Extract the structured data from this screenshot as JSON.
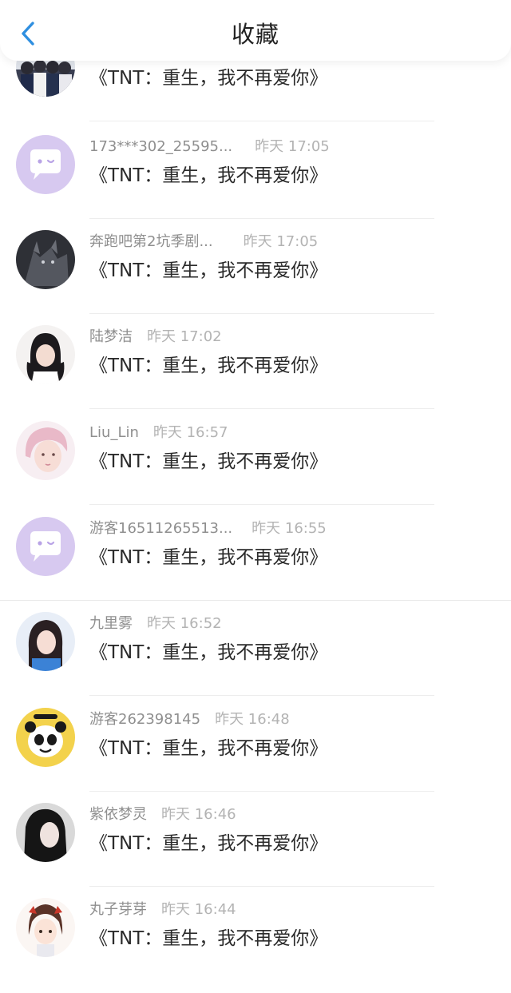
{
  "header": {
    "title": "收藏",
    "back_icon": "chevron-left-icon",
    "accent": "#2f8fe0"
  },
  "items": [
    {
      "name": "",
      "time": "",
      "message": "《TNT：重生，我不再爱你》",
      "avatar": "group-photo"
    },
    {
      "name": "173***302_25595...",
      "time": "昨天 17:05",
      "message": "《TNT：重生，我不再爱你》",
      "avatar": "default-chat-bubble"
    },
    {
      "name": "奔跑吧第2坑季剧...",
      "time": "昨天 17:05",
      "message": "《TNT：重生，我不再爱你》",
      "avatar": "dark-wolf"
    },
    {
      "name": "陆梦洁",
      "time": "昨天 17:02",
      "message": "《TNT：重生，我不再爱你》",
      "avatar": "girl-pigtails"
    },
    {
      "name": "Liu_Lin",
      "time": "昨天 16:57",
      "message": "《TNT：重生，我不再爱你》",
      "avatar": "pink-hair-boy"
    },
    {
      "name": "游客16511265513...",
      "time": "昨天 16:55",
      "message": "《TNT：重生，我不再爱你》",
      "avatar": "default-chat-bubble"
    },
    {
      "name": "九里雾",
      "time": "昨天 16:52",
      "message": "《TNT：重生，我不再爱你》",
      "avatar": "girl-blue-shirt"
    },
    {
      "name": "游客262398145",
      "time": "昨天 16:48",
      "message": "《TNT：重生，我不再爱你》",
      "avatar": "panda-meme"
    },
    {
      "name": "紫依梦灵",
      "time": "昨天 16:46",
      "message": "《TNT：重生，我不再爱你》",
      "avatar": "dark-hair-girl"
    },
    {
      "name": "丸子芽芽",
      "time": "昨天 16:44",
      "message": "《TNT：重生，我不再爱你》",
      "avatar": "anime-girl"
    }
  ]
}
